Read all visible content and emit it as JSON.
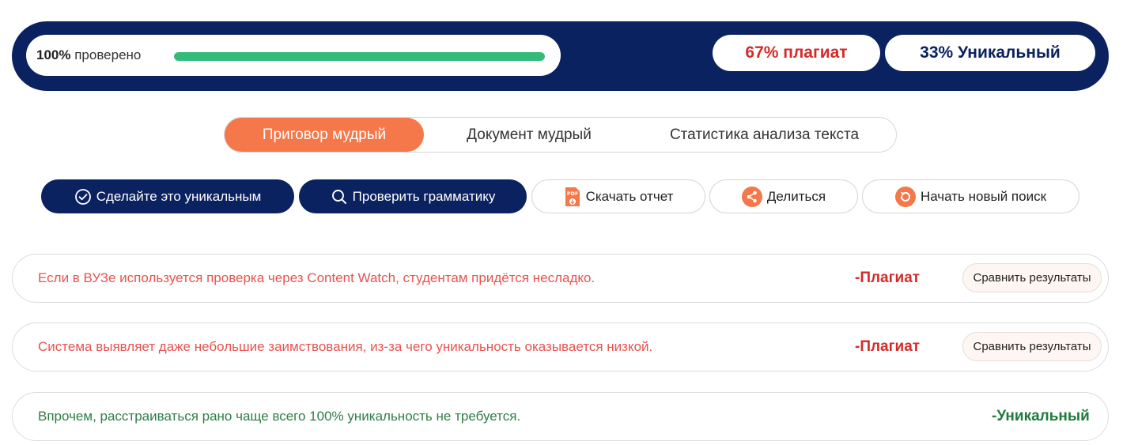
{
  "colors": {
    "navy": "#0b2260",
    "accent_orange": "#f4784a",
    "progress_green": "#33bb7b",
    "plagiarism_red": "#d52a2a",
    "plagiarism_text_red": "#e8534f",
    "unique_green": "#1f7a3a",
    "unique_text_green": "#2e7d46"
  },
  "progress": {
    "percent_label": "100%",
    "label": "проверено",
    "value_percent": 100
  },
  "scores": {
    "plagiarism": "67% плагиат",
    "unique": "33% Уникальный"
  },
  "tabs": [
    {
      "label": "Приговор мудрый",
      "active": true
    },
    {
      "label": "Документ мудрый",
      "active": false
    },
    {
      "label": "Статистика анализа текста",
      "active": false
    }
  ],
  "actions": {
    "make_unique": {
      "label": "Сделайте это уникальным",
      "icon": "check-circle-icon"
    },
    "check_grammar": {
      "label": "Проверить грамматику",
      "icon": "search-icon"
    },
    "download_report": {
      "label": "Скачать отчет",
      "icon": "pdf-download-icon",
      "icon_text": "PDF"
    },
    "share": {
      "label": "Делиться",
      "icon": "share-icon"
    },
    "new_search": {
      "label": "Начать новый поиск",
      "icon": "refresh-icon"
    }
  },
  "results": [
    {
      "text": "Если в ВУЗе используется проверка через Content Watch, студентам придётся несладко.",
      "status": "-Плагиат",
      "type": "plagiarism",
      "compare_label": "Сравнить результаты"
    },
    {
      "text": "Система выявляет даже небольшие заимствования, из-за чего уникальность оказывается низкой.",
      "status": "-Плагиат",
      "type": "plagiarism",
      "compare_label": "Сравнить результаты"
    },
    {
      "text": "Впрочем, расстраиваться рано чаще всего 100% уникальность не требуется.",
      "status": "-Уникальный",
      "type": "unique"
    }
  ]
}
